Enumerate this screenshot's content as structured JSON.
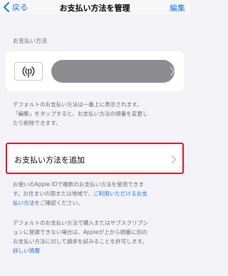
{
  "nav": {
    "back_label": "戻る",
    "title": "お支払い方法を管理",
    "edit_label": "編集"
  },
  "payment_section": {
    "header": "お支払い方法"
  },
  "default_note": {
    "line1": "デフォルトのお支払い方法は一番上に表示されます。",
    "line2": "「編集」をタップすると、お支払い方法の順番を変更し",
    "line3": "たり削除できます。"
  },
  "add_payment": {
    "label": "お支払い方法を追加"
  },
  "apple_note": {
    "line1": "お使いのApple IDで複数のお支払い方法を使用できま",
    "line2_pre": "す。お住まいの国または地域で、",
    "link": "ご利用いただけるお支",
    "link_cont": "払い方法",
    "line3_post": "をご確認ください。"
  },
  "subscription_note": {
    "line1": "デフォルトのお支払い方法で購入またはサブスクリプシ",
    "line2": "ョンに登録できない場合は、Appleが上から順番に別の",
    "line3": "お支払い方法に対して請求を試みることを許可します。",
    "link": "詳しい情報"
  },
  "colors": {
    "accent": "#1477f8",
    "highlight_border": "#e0141c",
    "background": "#f2f2f7"
  }
}
